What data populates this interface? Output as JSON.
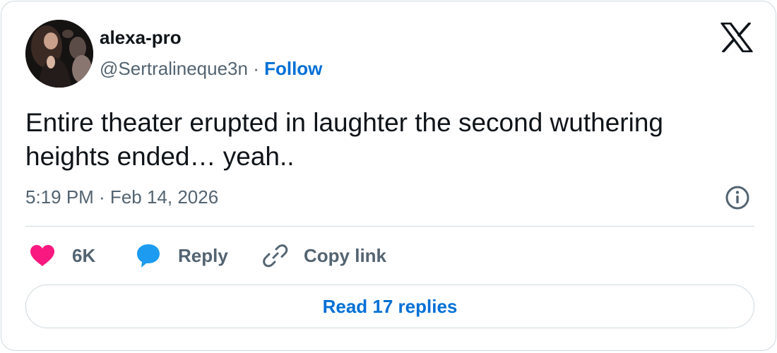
{
  "author": {
    "name": "alexa-pro",
    "handle": "@Sertralineque3n",
    "separator": "·",
    "follow_label": "Follow"
  },
  "tweet": {
    "text": "Entire theater erupted in laughter the second wuthering heights ended… yeah..",
    "timestamp": "5:19 PM · Feb 14, 2026"
  },
  "actions": {
    "like_count": "6K",
    "reply_label": "Reply",
    "copy_label": "Copy link"
  },
  "read_replies_label": "Read 17 replies",
  "icons": {
    "logo": "x-logo-icon",
    "info": "info-icon",
    "like": "heart-icon",
    "reply": "speech-bubble-icon",
    "copy": "link-icon"
  },
  "colors": {
    "text": "#0f1419",
    "secondary": "#536471",
    "link": "#006fd6",
    "like": "#f91880",
    "reply": "#1d9bf0",
    "border": "#cfd9de"
  }
}
